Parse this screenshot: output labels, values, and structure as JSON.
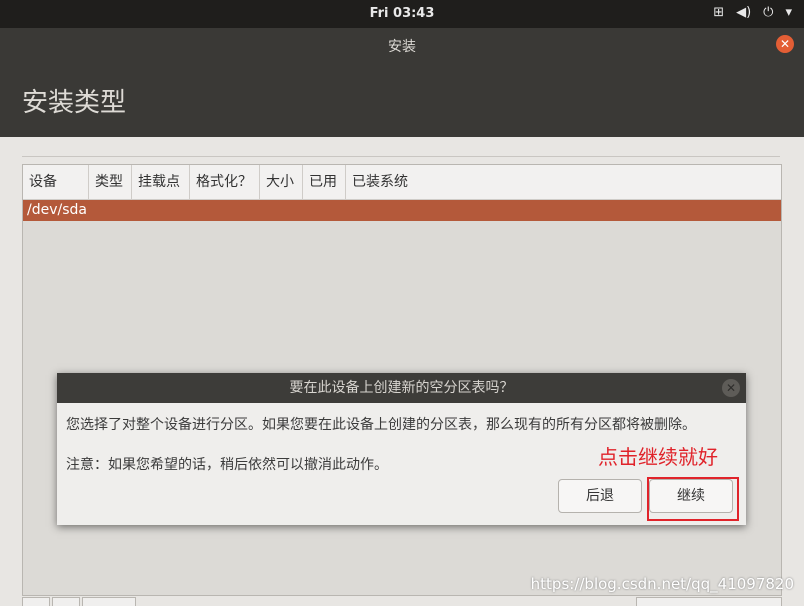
{
  "topbar": {
    "clock": "Fri 03:43",
    "icons": [
      "network-icon",
      "volume-icon",
      "power-icon",
      "dropdown-icon"
    ]
  },
  "window": {
    "title": "安装",
    "heading": "安装类型"
  },
  "table": {
    "columns": [
      "设备",
      "类型",
      "挂载点",
      "格式化？",
      "大小",
      "已用",
      "已装系统"
    ],
    "rows": [
      {
        "device": "/dev/sda"
      }
    ]
  },
  "dialog": {
    "title": "要在此设备上创建新的空分区表吗？",
    "message": "您选择了对整个设备进行分区。如果您要在此设备上创建的分区表，那么现有的所有分区都将被删除。",
    "note": "注意：如果您希望的话，稍后依然可以撤消此动作。",
    "back_label": "后退",
    "continue_label": "继续"
  },
  "annotation": "点击继续就好",
  "watermark": "https://blog.csdn.net/qq_41097820",
  "colors": {
    "accent": "#b4593a",
    "annotation": "#e0232a",
    "dark": "#3a3936"
  }
}
